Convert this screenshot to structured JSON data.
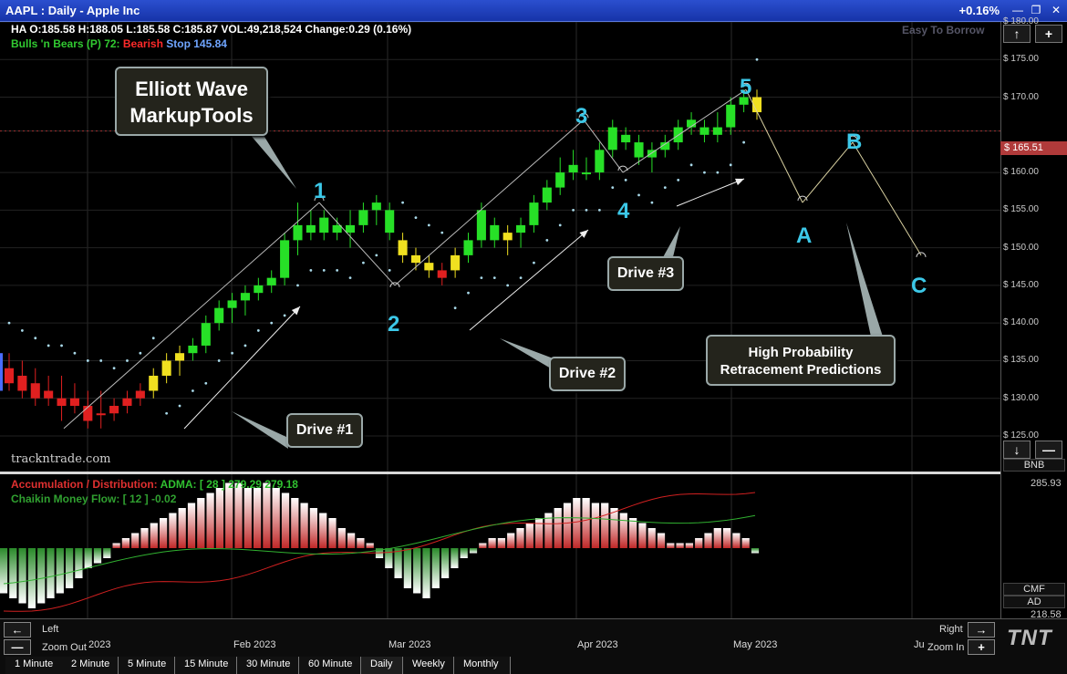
{
  "window": {
    "title": "AAPL : Daily   -   Apple Inc",
    "change_pct": "+0.16%",
    "minimize": "—",
    "restore": "❐",
    "close": "✕"
  },
  "header": {
    "ohlc": "HA O:185.58   H:188.05   L:185.58   C:185.87   VOL:49,218,524   Change:0.29 (0.16%)",
    "bulls_label": "Bulls 'n Bears (P) 72: ",
    "bearish": "Bearish",
    "stop": "Stop 145.84",
    "easy_to_borrow": "Easy To Borrow"
  },
  "price_axis": {
    "labels": [
      "$ 180.00",
      "$ 175.00",
      "$ 170.00",
      "$ 165.51",
      "$ 160.00",
      "$ 155.00",
      "$ 150.00",
      "$ 145.00",
      "$ 140.00",
      "$ 135.00",
      "$ 130.00",
      "$ 125.00"
    ],
    "current_price": "$ 165.51",
    "current_price_color": "#b03a3a",
    "bnb": "BNB",
    "ad_value": "285.93",
    "cmf_label": "CMF",
    "ad_label": "AD",
    "ad_bottom": "218.58"
  },
  "indicators": {
    "ad_title": "Accumulation / Distribution:",
    "adma": "ADMA: [ 28 ] 279.29",
    "adma_value": "279.18",
    "cmf": "Chaikin Money Flow: [ 12 ] -0.02"
  },
  "annotations": {
    "title_callout": [
      "Elliott Wave",
      "MarkupTools"
    ],
    "drive1": "Drive #1",
    "drive2": "Drive #2",
    "drive3": "Drive #3",
    "predictions": [
      "High Probability",
      "Retracement Predictions"
    ],
    "waves": [
      "1",
      "2",
      "3",
      "4",
      "5",
      "A",
      "B",
      "C"
    ]
  },
  "watermark": "trackntrade.com",
  "navigation": {
    "left": "Left",
    "right": "Right",
    "zoom_out": "Zoom Out",
    "zoom_in": "Zoom In",
    "months": [
      "2023",
      "Feb 2023",
      "Mar 2023",
      "Apr 2023",
      "May 2023",
      "Ju"
    ]
  },
  "timeframes": [
    "1 Minute",
    "2 Minute",
    "5 Minute",
    "15 Minute",
    "30 Minute",
    "60 Minute",
    "Daily",
    "Weekly",
    "Monthly"
  ],
  "active_timeframe": "Daily",
  "logo": "TNT",
  "colors": {
    "bull": "#27e027",
    "bear": "#e02020",
    "neutral": "#f0e020",
    "wave_label": "#3cc8e8",
    "stop_dots": "#a8d8e8"
  },
  "chart_data": {
    "type": "candlestick",
    "title": "AAPL : Daily - Apple Inc",
    "x_range": [
      "2023-01-03",
      "2023-05-05"
    ],
    "ylim": [
      125,
      180
    ],
    "candles": [
      {
        "o": 134,
        "h": 136,
        "l": 131,
        "c": 132,
        "color": "bear"
      },
      {
        "o": 133,
        "h": 135,
        "l": 130,
        "c": 131,
        "color": "bear"
      },
      {
        "o": 132,
        "h": 134,
        "l": 129,
        "c": 130,
        "color": "bear"
      },
      {
        "o": 131,
        "h": 133,
        "l": 129,
        "c": 130,
        "color": "bear"
      },
      {
        "o": 130,
        "h": 133,
        "l": 127,
        "c": 129,
        "color": "bear"
      },
      {
        "o": 130,
        "h": 132,
        "l": 128,
        "c": 129,
        "color": "bear"
      },
      {
        "o": 129,
        "h": 131,
        "l": 126,
        "c": 127,
        "color": "bear"
      },
      {
        "o": 128,
        "h": 131,
        "l": 126,
        "c": 128,
        "color": "bear"
      },
      {
        "o": 128,
        "h": 130,
        "l": 127,
        "c": 129,
        "color": "bear"
      },
      {
        "o": 129,
        "h": 131,
        "l": 128,
        "c": 130,
        "color": "bear"
      },
      {
        "o": 130,
        "h": 132,
        "l": 129,
        "c": 131,
        "color": "bear"
      },
      {
        "o": 131,
        "h": 134,
        "l": 130,
        "c": 133,
        "color": "neutral"
      },
      {
        "o": 133,
        "h": 136,
        "l": 132,
        "c": 135,
        "color": "neutral"
      },
      {
        "o": 135,
        "h": 137,
        "l": 133,
        "c": 136,
        "color": "neutral"
      },
      {
        "o": 136,
        "h": 138,
        "l": 135,
        "c": 137,
        "color": "bull"
      },
      {
        "o": 137,
        "h": 141,
        "l": 136,
        "c": 140,
        "color": "bull"
      },
      {
        "o": 140,
        "h": 143,
        "l": 139,
        "c": 142,
        "color": "bull"
      },
      {
        "o": 142,
        "h": 144,
        "l": 140,
        "c": 143,
        "color": "bull"
      },
      {
        "o": 143,
        "h": 145,
        "l": 141,
        "c": 144,
        "color": "bull"
      },
      {
        "o": 144,
        "h": 146,
        "l": 143,
        "c": 145,
        "color": "bull"
      },
      {
        "o": 145,
        "h": 147,
        "l": 144,
        "c": 146,
        "color": "bull"
      },
      {
        "o": 146,
        "h": 152,
        "l": 145,
        "c": 151,
        "color": "bull"
      },
      {
        "o": 151,
        "h": 156,
        "l": 149,
        "c": 153,
        "color": "bull"
      },
      {
        "o": 153,
        "h": 155,
        "l": 151,
        "c": 152,
        "color": "bull"
      },
      {
        "o": 152,
        "h": 155,
        "l": 151,
        "c": 154,
        "color": "bull"
      },
      {
        "o": 153,
        "h": 154,
        "l": 151,
        "c": 152,
        "color": "bull"
      },
      {
        "o": 152,
        "h": 155,
        "l": 150,
        "c": 153,
        "color": "bull"
      },
      {
        "o": 153,
        "h": 156,
        "l": 152,
        "c": 155,
        "color": "bull"
      },
      {
        "o": 155,
        "h": 157,
        "l": 153,
        "c": 156,
        "color": "bull"
      },
      {
        "o": 155,
        "h": 156,
        "l": 151,
        "c": 152,
        "color": "bull"
      },
      {
        "o": 151,
        "h": 152,
        "l": 148,
        "c": 149,
        "color": "neutral"
      },
      {
        "o": 149,
        "h": 150,
        "l": 147,
        "c": 148,
        "color": "neutral"
      },
      {
        "o": 148,
        "h": 149,
        "l": 146,
        "c": 147,
        "color": "neutral"
      },
      {
        "o": 147,
        "h": 148,
        "l": 145,
        "c": 146,
        "color": "bear"
      },
      {
        "o": 147,
        "h": 150,
        "l": 146,
        "c": 149,
        "color": "neutral"
      },
      {
        "o": 149,
        "h": 152,
        "l": 148,
        "c": 151,
        "color": "bull"
      },
      {
        "o": 151,
        "h": 156,
        "l": 150,
        "c": 155,
        "color": "bull"
      },
      {
        "o": 153,
        "h": 154,
        "l": 150,
        "c": 151,
        "color": "bull"
      },
      {
        "o": 151,
        "h": 153,
        "l": 149,
        "c": 152,
        "color": "neutral"
      },
      {
        "o": 152,
        "h": 154,
        "l": 150,
        "c": 153,
        "color": "bull"
      },
      {
        "o": 153,
        "h": 157,
        "l": 152,
        "c": 156,
        "color": "bull"
      },
      {
        "o": 156,
        "h": 159,
        "l": 155,
        "c": 158,
        "color": "bull"
      },
      {
        "o": 158,
        "h": 162,
        "l": 157,
        "c": 160,
        "color": "bull"
      },
      {
        "o": 160,
        "h": 163,
        "l": 159,
        "c": 161,
        "color": "bull"
      },
      {
        "o": 160,
        "h": 162,
        "l": 159,
        "c": 160,
        "color": "bull"
      },
      {
        "o": 160,
        "h": 164,
        "l": 159,
        "c": 163,
        "color": "bull"
      },
      {
        "o": 163,
        "h": 167,
        "l": 162,
        "c": 166,
        "color": "bull"
      },
      {
        "o": 165,
        "h": 166,
        "l": 163,
        "c": 164,
        "color": "bull"
      },
      {
        "o": 164,
        "h": 165,
        "l": 161,
        "c": 162,
        "color": "bull"
      },
      {
        "o": 162,
        "h": 164,
        "l": 160,
        "c": 163,
        "color": "bull"
      },
      {
        "o": 163,
        "h": 165,
        "l": 162,
        "c": 164,
        "color": "bull"
      },
      {
        "o": 164,
        "h": 167,
        "l": 163,
        "c": 166,
        "color": "bull"
      },
      {
        "o": 166,
        "h": 168,
        "l": 165,
        "c": 167,
        "color": "bull"
      },
      {
        "o": 166,
        "h": 167,
        "l": 164,
        "c": 165,
        "color": "bull"
      },
      {
        "o": 165,
        "h": 168,
        "l": 164,
        "c": 166,
        "color": "bull"
      },
      {
        "o": 166,
        "h": 170,
        "l": 165,
        "c": 169,
        "color": "bull"
      },
      {
        "o": 169,
        "h": 171,
        "l": 168,
        "c": 170,
        "color": "bull"
      },
      {
        "o": 170,
        "h": 171,
        "l": 167,
        "c": 168,
        "color": "neutral"
      }
    ],
    "wave_points": [
      {
        "label": "1",
        "price": 156
      },
      {
        "label": "2",
        "price": 145
      },
      {
        "label": "3",
        "price": 167
      },
      {
        "label": "4",
        "price": 160
      },
      {
        "label": "5",
        "price": 171
      },
      {
        "label": "A",
        "price": 156
      },
      {
        "label": "B",
        "price": 164
      },
      {
        "label": "C",
        "price": 149
      }
    ],
    "ad_bars": [
      -9,
      -10,
      -11,
      -12,
      -11,
      -10,
      -9,
      -8,
      -6,
      -4,
      -3,
      -2,
      1,
      2,
      3,
      4,
      5,
      6,
      7,
      8,
      9,
      10,
      11,
      12,
      13,
      13,
      12,
      12,
      13,
      12,
      11,
      10,
      9,
      8,
      7,
      6,
      4,
      3,
      2,
      1,
      -2,
      -4,
      -6,
      -8,
      -9,
      -10,
      -8,
      -6,
      -4,
      -2,
      -1,
      1,
      2,
      2,
      3,
      4,
      5,
      6,
      7,
      8,
      9,
      10,
      10,
      9,
      9,
      8,
      7,
      6,
      5,
      4,
      3,
      1,
      1,
      1,
      2,
      3,
      4,
      4,
      3,
      2,
      -1
    ]
  }
}
